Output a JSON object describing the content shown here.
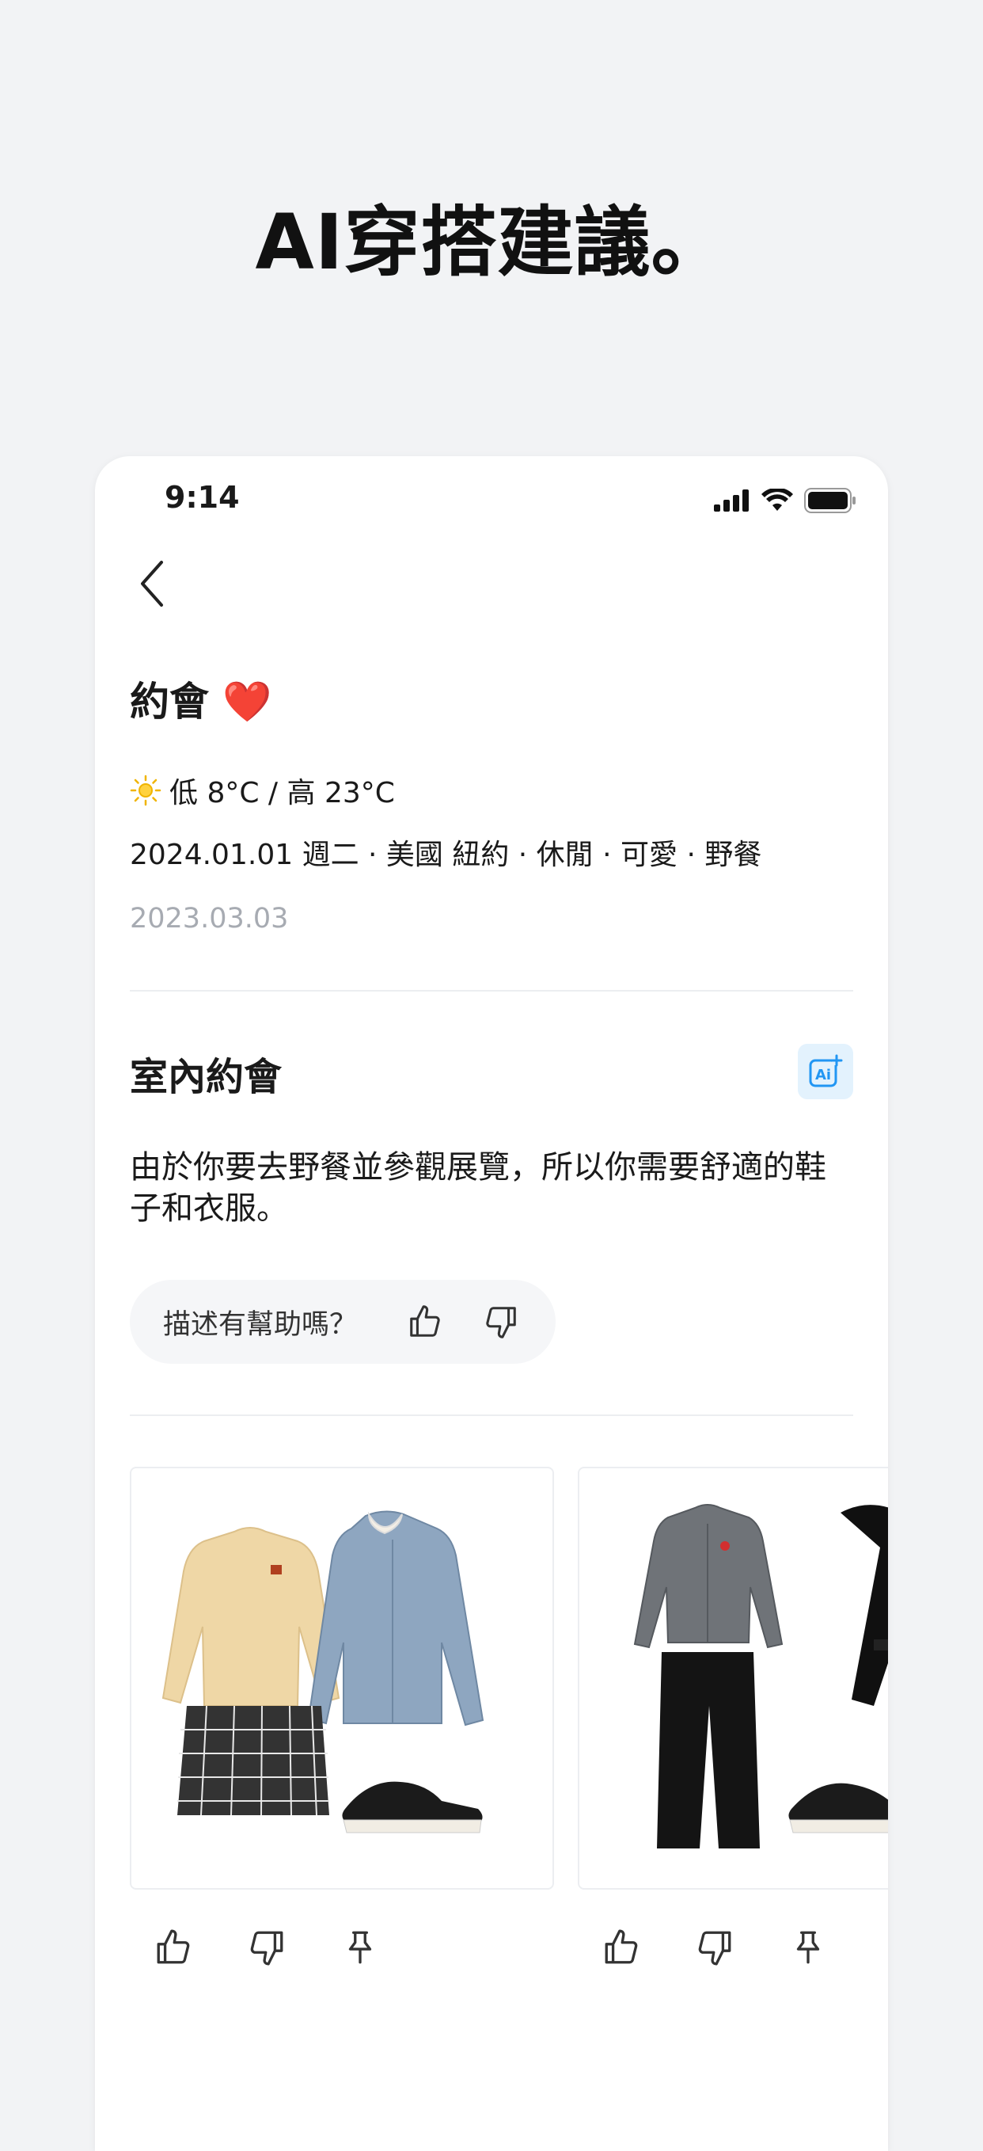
{
  "headline": "AI穿搭建議。",
  "status_bar": {
    "time": "9:14"
  },
  "outfit": {
    "title": "約會",
    "emoji": "❤️",
    "weather": "低 8°C / 高 23°C",
    "meta": "2024.01.01 週二 · 美國 紐約 · 休閒 · 可愛 · 野餐",
    "created_date": "2023.03.03"
  },
  "section": {
    "title": "室內約會",
    "description": "由於你要去野餐並參觀展覽，所以你需要舒適的鞋子和衣服。"
  },
  "feedback": {
    "label": "描述有幫助嗎？"
  },
  "colors": {
    "accent": "#2196f3",
    "accent_bg": "#e3f2fd",
    "muted": "#a7abb2",
    "page_bg": "#f2f3f5"
  },
  "cards": [
    {
      "items": [
        "beige-sweater",
        "denim-jacket",
        "plaid-skirt",
        "black-sneakers"
      ]
    },
    {
      "items": [
        "gray-cardigan",
        "black-coat",
        "black-trousers",
        "black-sneakers"
      ]
    }
  ]
}
